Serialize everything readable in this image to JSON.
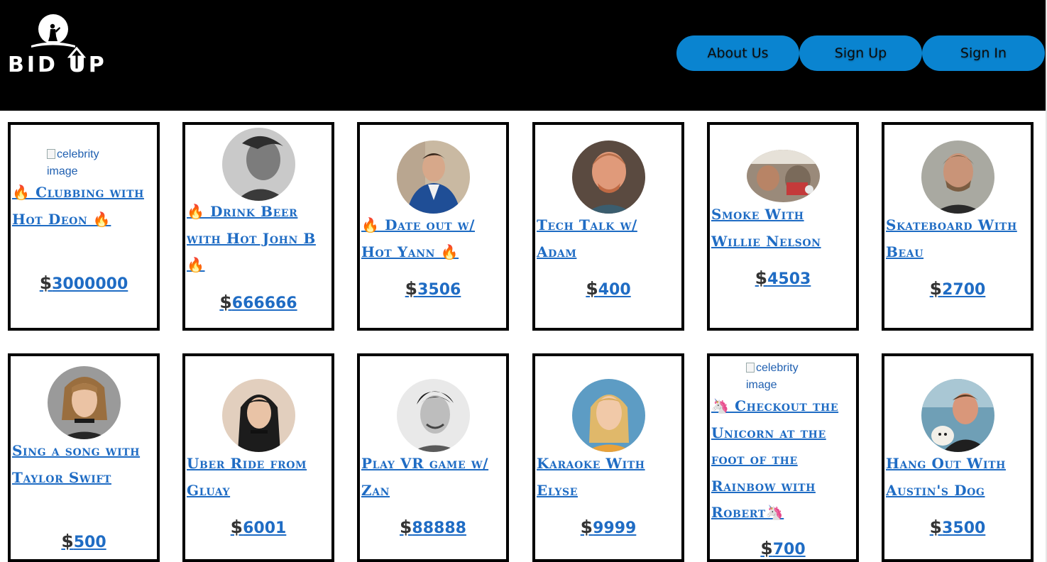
{
  "header": {
    "logo_text": "BID UP",
    "nav": [
      {
        "label": "About Us"
      },
      {
        "label": "Sign Up"
      },
      {
        "label": "Sign In"
      }
    ]
  },
  "broken_image_alt": "celebrity image",
  "currency_symbol": "$",
  "cards": [
    {
      "title": "🔥 Clubbing with Hot Deon 🔥",
      "price": "3000000",
      "image": "broken"
    },
    {
      "title": "🔥 Drink Beer with Hot John B🔥",
      "price": "666666",
      "image": "photo"
    },
    {
      "title": "🔥 Date out w/ Hot Yann 🔥",
      "price": "3506",
      "image": "photo"
    },
    {
      "title": "Tech Talk w/ Adam",
      "price": "400",
      "image": "photo"
    },
    {
      "title": "Smoke With Willie Nelson",
      "price": "4503",
      "image": "photo"
    },
    {
      "title": "Skateboard With Beau",
      "price": "2700",
      "image": "photo"
    },
    {
      "title": "Sing a song with Taylor Swift",
      "price": "500",
      "image": "photo"
    },
    {
      "title": "Uber Ride from Gluay",
      "price": "6001",
      "image": "photo"
    },
    {
      "title": "Play VR game w/ Zan",
      "price": "88888",
      "image": "photo"
    },
    {
      "title": "Karaoke With Elyse",
      "price": "9999",
      "image": "photo"
    },
    {
      "title": "🦄 Checkout the Unicorn at the foot of the Rainbow with Robert🦄",
      "price": "700",
      "image": "broken"
    },
    {
      "title": "Hang Out With Austin's Dog",
      "price": "3500",
      "image": "photo"
    }
  ]
}
